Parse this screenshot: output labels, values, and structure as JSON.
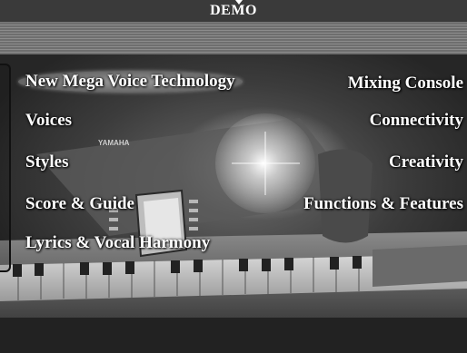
{
  "window": {
    "title": "DEMO"
  },
  "menu": {
    "left": [
      {
        "label": "New Mega Voice Technology",
        "selected": true
      },
      {
        "label": "Voices",
        "selected": false
      },
      {
        "label": "Styles",
        "selected": false
      },
      {
        "label": "Score & Guide",
        "selected": false
      },
      {
        "label": "Lyrics & Vocal Harmony",
        "selected": false
      }
    ],
    "right": [
      {
        "label": "Mixing Console",
        "selected": false
      },
      {
        "label": "Connectivity",
        "selected": false
      },
      {
        "label": "Creativity",
        "selected": false
      },
      {
        "label": "Functions & Features",
        "selected": false
      }
    ]
  },
  "background": {
    "brand_text": "YAMAHA"
  },
  "colors": {
    "title_bar": "#3a3a3a",
    "menu_text": "#ffffff",
    "selected_highlight": "#8a8a8a"
  }
}
